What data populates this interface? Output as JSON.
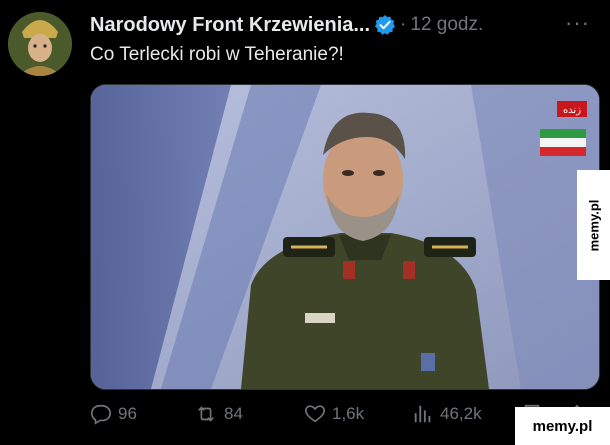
{
  "tweet": {
    "author_name": "Narodowy Front Krzewienia...",
    "separator": "·",
    "time": "12 godz.",
    "more_label": "···",
    "text": "Co Terlecki robi w Teheranie?!"
  },
  "media": {
    "channel_badge": "زنده",
    "description_colors": {
      "background": "#a6b0cf",
      "uniform": "#3f4528"
    }
  },
  "actions": {
    "replies": "96",
    "reposts": "84",
    "likes": "1,6k",
    "views": "46,2k"
  },
  "watermarks": {
    "side": "memy.pl",
    "bottom": "memy.pl"
  }
}
